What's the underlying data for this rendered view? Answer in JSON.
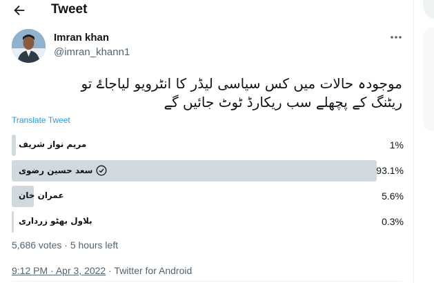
{
  "header": {
    "title": "Tweet",
    "back_icon": "arrow-left-icon"
  },
  "author": {
    "name": "Imran khan",
    "handle": "@imran_khann1",
    "more_icon": "more-horizontal-icon"
  },
  "tweet": {
    "text_line1": "موجودہ حالات میں کس سیاسی لیڈر کا انٹرویو لیاجاۓ تو",
    "text_line2": "ریٹنگ کے پچھلے سب ریکارڈ ٹوٹ جائیں گے",
    "translate_label": "Translate Tweet"
  },
  "poll": {
    "options": [
      {
        "label": "مریم نواز شریف",
        "percent_label": "1%",
        "percent": 1.0,
        "winner": false
      },
      {
        "label": "سعد حسین رضوی",
        "percent_label": "93.1%",
        "percent": 93.1,
        "winner": true
      },
      {
        "label": "عمران خان",
        "percent_label": "5.6%",
        "percent": 5.6,
        "winner": false
      },
      {
        "label": "بلاول بھٹو زرداری",
        "percent_label": "0.3%",
        "percent": 0.3,
        "winner": false
      }
    ],
    "votes": "5,686 votes",
    "separator": "·",
    "time_left": "5 hours left",
    "bar_color": "#cfd9de"
  },
  "meta": {
    "time": "9:12 PM",
    "dot": "·",
    "date": "Apr 3, 2022",
    "source": "Twitter for Android",
    "link_color": "#536471",
    "accent": "#1d9bf0"
  }
}
